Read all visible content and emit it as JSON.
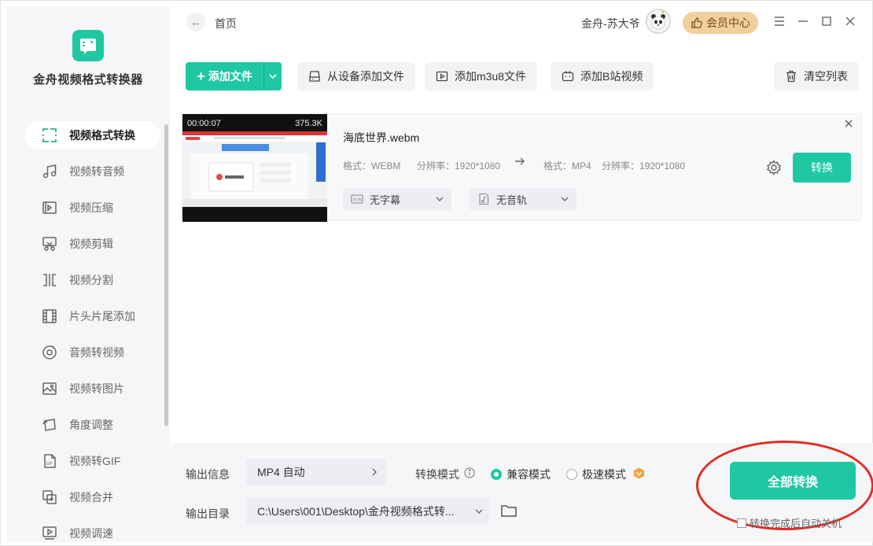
{
  "app": {
    "name": "金舟视频格式转换器",
    "accent": "#1fc8a3",
    "highlight_color": "#e42b24"
  },
  "sidebar": {
    "items": [
      {
        "label": "视频格式转换",
        "icon": "convert-icon",
        "active": true
      },
      {
        "label": "视频转音频",
        "icon": "music-note-icon",
        "active": false
      },
      {
        "label": "视频压缩",
        "icon": "compress-icon",
        "active": false
      },
      {
        "label": "视频剪辑",
        "icon": "scissors-icon",
        "active": false
      },
      {
        "label": "视频分割",
        "icon": "split-icon",
        "active": false
      },
      {
        "label": "片头片尾添加",
        "icon": "film-icon",
        "active": false
      },
      {
        "label": "音频转视频",
        "icon": "disc-icon",
        "active": false
      },
      {
        "label": "视频转图片",
        "icon": "image-icon",
        "active": false
      },
      {
        "label": "角度调整",
        "icon": "rotate-icon",
        "active": false
      },
      {
        "label": "视频转GIF",
        "icon": "gif-file-icon",
        "active": false
      },
      {
        "label": "视频合并",
        "icon": "merge-icon",
        "active": false
      },
      {
        "label": "视频调速",
        "icon": "speed-icon",
        "active": false
      }
    ]
  },
  "header": {
    "breadcrumb": "首页",
    "user_name": "金舟-苏大爷",
    "vip_label": "会员中心"
  },
  "toolbar": {
    "add_file": "添加文件",
    "add_from_device": "从设备添加文件",
    "add_m3u8": "添加m3u8文件",
    "add_bilibili": "添加B站视频",
    "clear_list": "清空列表"
  },
  "file": {
    "name": "海底世界.webm",
    "duration": "00:00:07",
    "size": "375.3K",
    "src_format": "格式：WEBM",
    "src_resolution": "分辨率：1920*1080",
    "dst_format": "格式：MP4",
    "dst_resolution": "分辨率：1920*1080",
    "subtitle": "无字幕",
    "audio_track": "无音轨",
    "convert_label": "转换"
  },
  "bottom": {
    "output_info_label": "输出信息",
    "output_info_value": "MP4 自动",
    "convert_mode_label": "转换模式",
    "mode_compatible": "兼容模式",
    "mode_fast": "极速模式",
    "output_dir_label": "输出目录",
    "output_dir_value": "C:\\Users\\001\\Desktop\\金舟视频格式转...",
    "convert_all": "全部转换",
    "auto_shutdown": "转换完成后自动关机"
  }
}
